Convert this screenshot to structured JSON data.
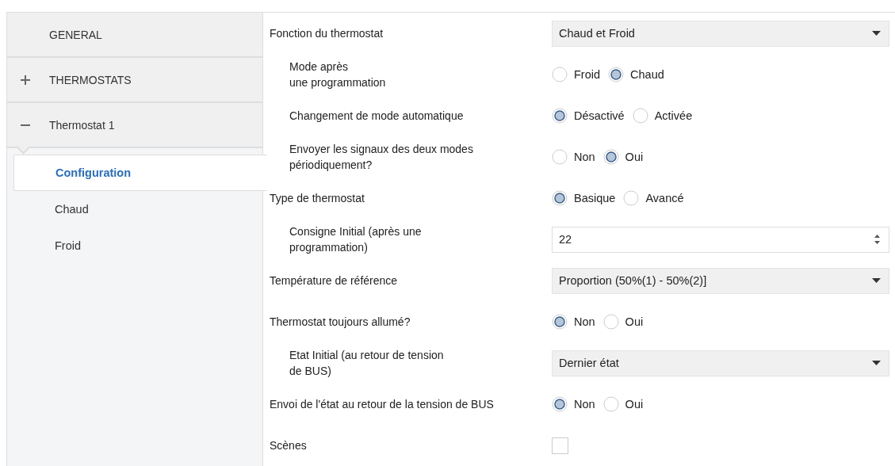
{
  "sidebar": {
    "items": [
      {
        "label": "GENERAL"
      },
      {
        "label": "THERMOSTATS",
        "expanded": false
      },
      {
        "label": "Thermostat 1",
        "expanded": true,
        "children": [
          {
            "label": "Configuration",
            "selected": true
          },
          {
            "label": "Chaud",
            "selected": false
          },
          {
            "label": "Froid",
            "selected": false
          }
        ]
      }
    ]
  },
  "settings": [
    {
      "label": "Fonction du thermostat",
      "indented": false,
      "kind": "dropdown",
      "value": "Chaud et Froid"
    },
    {
      "label": "Mode après\nune programmation",
      "indented": true,
      "kind": "radio",
      "options": [
        {
          "label": "Froid",
          "selected": false
        },
        {
          "label": "Chaud",
          "selected": true
        }
      ]
    },
    {
      "label": "Changement de mode automatique",
      "indented": true,
      "kind": "radio",
      "options": [
        {
          "label": "Désactivé",
          "selected": true
        },
        {
          "label": "Activée",
          "selected": false
        }
      ]
    },
    {
      "label": "Envoyer les signaux des deux modes\npériodiquement?",
      "indented": true,
      "kind": "radio",
      "options": [
        {
          "label": "Non",
          "selected": false
        },
        {
          "label": "Oui",
          "selected": true
        }
      ]
    },
    {
      "label": "Type de thermostat",
      "indented": false,
      "kind": "radio",
      "options": [
        {
          "label": "Basique",
          "selected": true
        },
        {
          "label": "Avancé",
          "selected": false
        }
      ]
    },
    {
      "label": "Consigne Initial (après une\nprogrammation)",
      "indented": true,
      "kind": "spin",
      "value": "22"
    },
    {
      "label": "Température de référence",
      "indented": false,
      "kind": "dropdown",
      "value": "Proportion (50%(1) - 50%(2)]"
    },
    {
      "label": "Thermostat toujours allumé?",
      "indented": false,
      "kind": "radio",
      "options": [
        {
          "label": "Non",
          "selected": true
        },
        {
          "label": "Oui",
          "selected": false
        }
      ]
    },
    {
      "label": "Etat Initial (au retour de tension\nde BUS)",
      "indented": true,
      "kind": "dropdown",
      "value": "Dernier état"
    },
    {
      "label": "Envoi de l'état au retour de la tension de BUS",
      "indented": false,
      "kind": "radio",
      "options": [
        {
          "label": "Non",
          "selected": true
        },
        {
          "label": "Oui",
          "selected": false
        }
      ]
    },
    {
      "label": "Scènes",
      "indented": false,
      "kind": "checkbox",
      "checked": false
    }
  ]
}
